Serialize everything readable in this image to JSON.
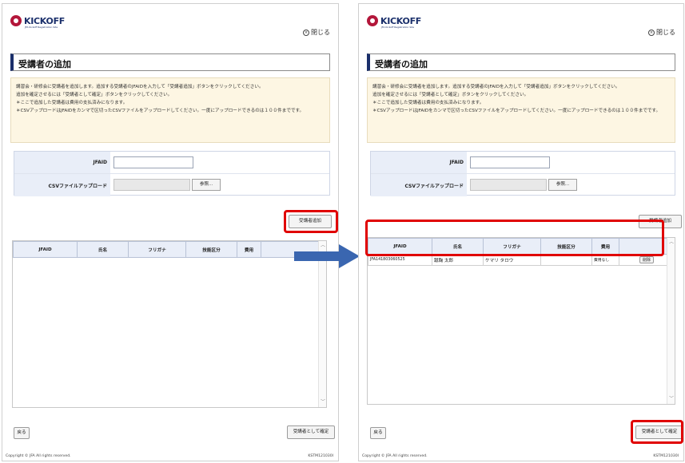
{
  "app": {
    "logo_text": "KICKOFF",
    "logo_sub": "JFA Kickoff Registration Site",
    "close_label": "閉じる"
  },
  "page": {
    "title": "受講者の追加",
    "info_lines": [
      "講習会・研修会に受講者を追加します。追加する受講者のJFAIDを入力して「受講者追加」ボタンをクリックしてください。",
      "追加を確定させるには「受講者として確定」ボタンをクリックしてください。",
      "＊ここで追加した受講者は費用の支払済みになります。",
      "＊CSVアップロードはJFAIDをカンマで区切ったCSVファイルをアップロードしてください。一度にアップロードできるのは１００件までです。"
    ],
    "form": {
      "jfaid_label": "JFAID",
      "jfaid_value": "",
      "csv_label": "CSVファイルアップロード",
      "browse_label": "参照..."
    },
    "add_button": "受講者追加",
    "table": {
      "headers": [
        "JFAID",
        "氏名",
        "フリガナ",
        "技能区分",
        "費用",
        ""
      ]
    },
    "back_button": "戻る",
    "confirm_button": "受講者として確定",
    "footer_copyright": "Copyright © JFA All rights reserved.",
    "footer_code": "KSTM121030I"
  },
  "right_row": {
    "jfaid": "JFA141803060525",
    "name": "蹴鞠 太郎",
    "kana": "ケマリ タロウ",
    "skill": "",
    "fee": "費用なし",
    "delete": "削除"
  },
  "colors": {
    "highlight": "#e00000",
    "arrow": "#3a66b0",
    "title_accent": "#1a2f6b"
  }
}
